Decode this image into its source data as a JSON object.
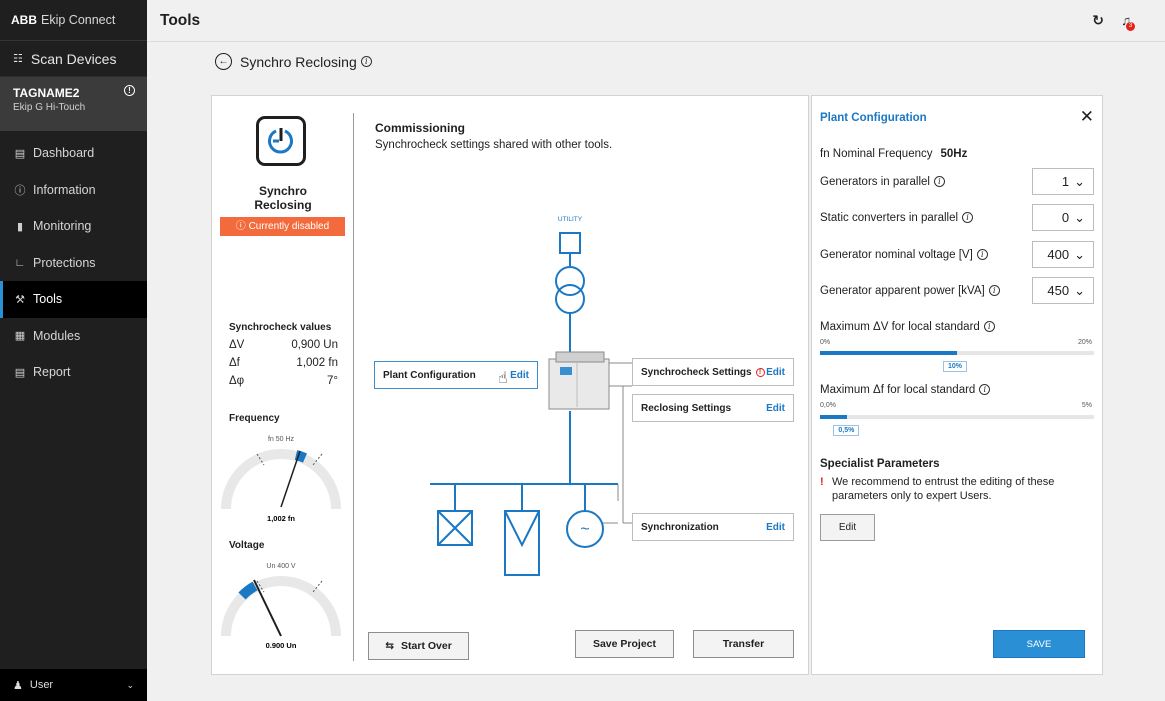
{
  "app": {
    "brand": "ABB",
    "name": "Ekip Connect"
  },
  "sidebar": {
    "scan_label": "Scan Devices",
    "device": {
      "tag": "TAGNAME2",
      "model": "Ekip G Hi-Touch"
    },
    "items": [
      {
        "label": "Dashboard",
        "icon": "dashboard-icon"
      },
      {
        "label": "Information",
        "icon": "info-icon"
      },
      {
        "label": "Monitoring",
        "icon": "bar-chart-icon"
      },
      {
        "label": "Protections",
        "icon": "protection-icon"
      },
      {
        "label": "Tools",
        "icon": "wrench-icon",
        "active": true
      },
      {
        "label": "Modules",
        "icon": "modules-icon"
      },
      {
        "label": "Report",
        "icon": "report-icon"
      }
    ],
    "user": "User"
  },
  "header": {
    "title": "Tools",
    "notification_count": "3"
  },
  "page": {
    "title": "Synchro Reclosing"
  },
  "tool": {
    "name": "Synchro Reclosing",
    "status": "Currently disabled",
    "synchrocheck": {
      "title": "Synchrocheck values",
      "rows": [
        {
          "label": "ΔV",
          "value": "0,900 Un"
        },
        {
          "label": "Δf",
          "value": "1,002 fn"
        },
        {
          "label": "Δφ",
          "value": "7°"
        }
      ]
    },
    "frequency": {
      "title": "Frequency",
      "nominal": "fn 50 Hz",
      "value": "1,002 fn"
    },
    "voltage": {
      "title": "Voltage",
      "nominal": "Un 400 V",
      "value": "0.900 Un"
    }
  },
  "commissioning": {
    "title": "Commissioning",
    "subtitle": "Synchrocheck settings shared with other tools.",
    "utility_label": "UTILITY",
    "steps": {
      "plant": "Plant Configuration",
      "synchrocheck": "Synchrocheck Settings",
      "reclosing": "Reclosing Settings",
      "synchronization": "Synchronization"
    },
    "edit_label": "Edit",
    "start_over": "Start Over",
    "save_project": "Save Project",
    "transfer": "Transfer"
  },
  "plant_config": {
    "title": "Plant Configuration",
    "nominal_freq_label": "fn Nominal Frequency",
    "nominal_freq_value": "50Hz",
    "fields": [
      {
        "label": "Generators in parallel",
        "value": "1"
      },
      {
        "label": "Static converters in parallel",
        "value": "0"
      },
      {
        "label": "Generator nominal voltage [V]",
        "value": "400"
      },
      {
        "label": "Generator apparent power [kVA]",
        "value": "450"
      }
    ],
    "max_dv": {
      "label": "Maximum ΔV for local standard",
      "min": "0%",
      "max": "20%",
      "value": "10%",
      "fraction": 0.5
    },
    "max_df": {
      "label": "Maximum Δf for local standard",
      "min": "0,0%",
      "max": "5%",
      "value": "0,5%",
      "fraction": 0.1
    },
    "specialist": {
      "title": "Specialist Parameters",
      "warning": "We recommend to entrust the editing of these parameters only to expert Users.",
      "edit_label": "Edit"
    },
    "save_label": "SAVE"
  },
  "colors": {
    "accent": "#1b78c4",
    "warning": "#f36b3d",
    "sidebar": "#1f1f1f"
  }
}
